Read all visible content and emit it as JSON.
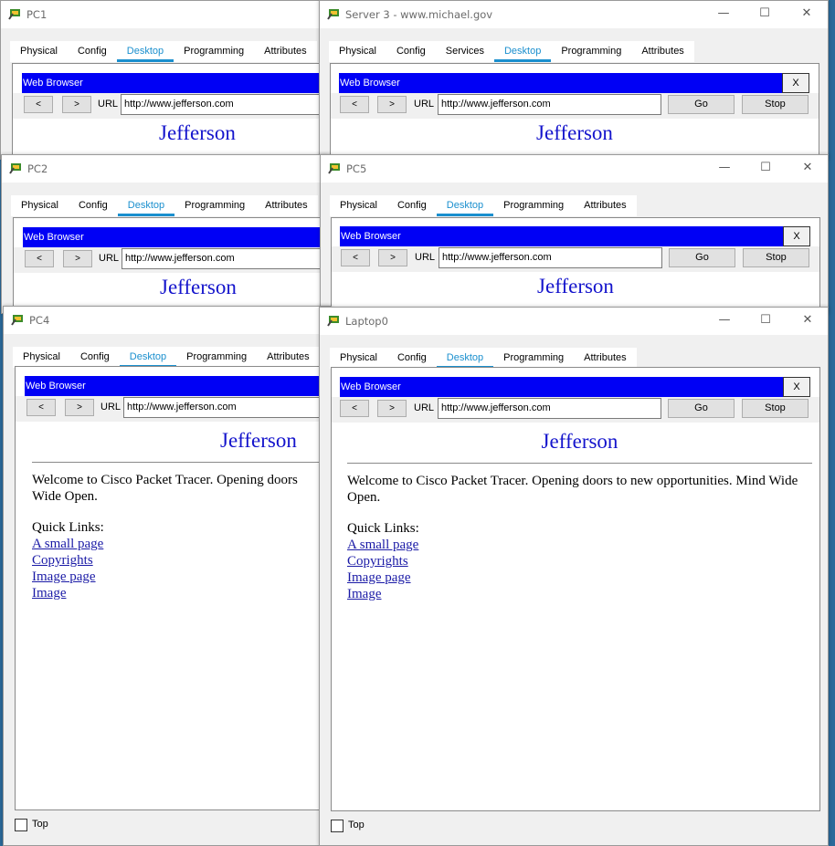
{
  "tabs_pc": [
    "Physical",
    "Config",
    "Desktop",
    "Programming",
    "Attributes"
  ],
  "tabs_server": [
    "Physical",
    "Config",
    "Services",
    "Desktop",
    "Programming",
    "Attributes"
  ],
  "controls": {
    "minimize": "—",
    "maximize": "☐",
    "close": "✕"
  },
  "browser": {
    "bar_title": "Web Browser",
    "close_label": "X",
    "back_label": "<",
    "forward_label": ">",
    "url_label": "URL",
    "url_value": "http://www.jefferson.com",
    "go_label": "Go",
    "stop_label": "Stop"
  },
  "page": {
    "title": "Jefferson",
    "welcome": "Welcome to Cisco Packet Tracer. Opening doors to new opportunities. Mind Wide Open.",
    "pc4_welcome_line1": "Welcome to Cisco Packet Tracer. Opening doors",
    "pc4_welcome_line2": "Wide Open.",
    "quick_links_label": "Quick Links:",
    "links": [
      "A small page",
      "Copyrights",
      "Image page",
      "Image"
    ]
  },
  "top_label": "Top",
  "windows": {
    "pc1": {
      "title": "PC1",
      "active_tab": "Desktop"
    },
    "server3": {
      "title": "Server 3 - www.michael.gov",
      "active_tab": "Desktop"
    },
    "pc2": {
      "title": "PC2",
      "active_tab": "Desktop"
    },
    "pc5": {
      "title": "PC5",
      "active_tab": "Desktop"
    },
    "pc4": {
      "title": "PC4",
      "active_tab": "Desktop"
    },
    "laptop0": {
      "title": "Laptop0",
      "active_tab": "Desktop"
    }
  },
  "colors": {
    "browser_bar": "#0000f5",
    "active_tab": "#1a8fce",
    "page_title": "#1414cc",
    "link": "#1a1aa6"
  }
}
